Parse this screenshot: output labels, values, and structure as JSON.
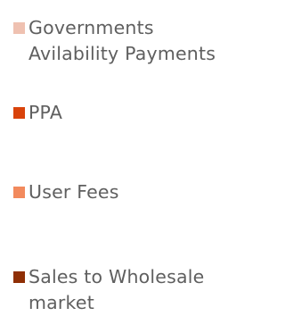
{
  "legend": {
    "items": [
      {
        "label": "Governments Avilability Payments",
        "color": "#efc1b1"
      },
      {
        "label": "PPA",
        "color": "#d9430b"
      },
      {
        "label": "User Fees",
        "color": "#f28a5d"
      },
      {
        "label": "Sales to Wholesale market",
        "color": "#8f2f05"
      }
    ]
  }
}
